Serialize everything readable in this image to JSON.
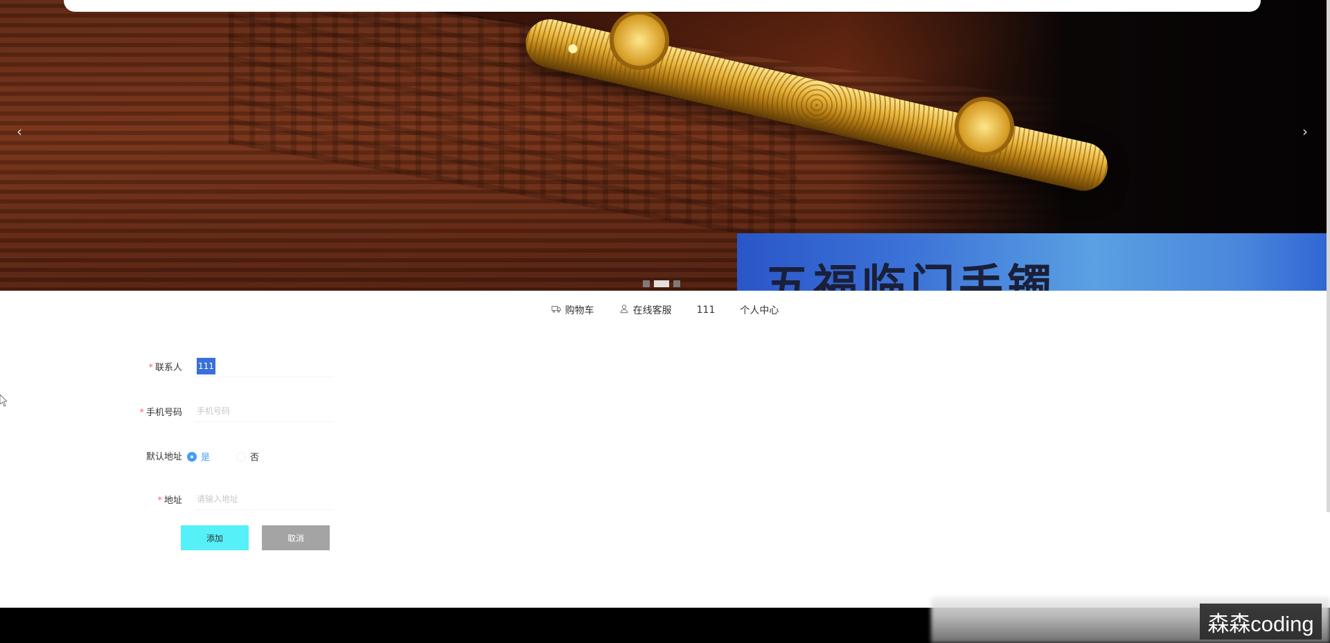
{
  "banner": {
    "promo_text": "五福临门手镯",
    "prev_icon": "chevron-left-icon",
    "next_icon": "chevron-right-icon",
    "slide_count": 3,
    "active_slide": 2
  },
  "nav": {
    "cart_label": "购物车",
    "cart_icon": "truck-icon",
    "service_label": "在线客服",
    "service_icon": "user-icon",
    "username": "111",
    "profile_label": "个人中心"
  },
  "form": {
    "contact": {
      "label": "联系人",
      "value": "111",
      "required": true
    },
    "phone": {
      "label": "手机号码",
      "placeholder": "手机号码",
      "required": true
    },
    "default_address": {
      "label": "默认地址",
      "options": [
        "是",
        "否"
      ],
      "selected": "是"
    },
    "address": {
      "label": "地址",
      "placeholder": "请输入地址",
      "required": true
    },
    "add_button": "添加",
    "cancel_button": "取消"
  },
  "watermark": "森森coding",
  "colors": {
    "add_button": "#55f0f8",
    "cancel_button": "#a4a4a4",
    "required": "#f56c6c",
    "radio_active": "#409eff",
    "footer": "#000000"
  }
}
